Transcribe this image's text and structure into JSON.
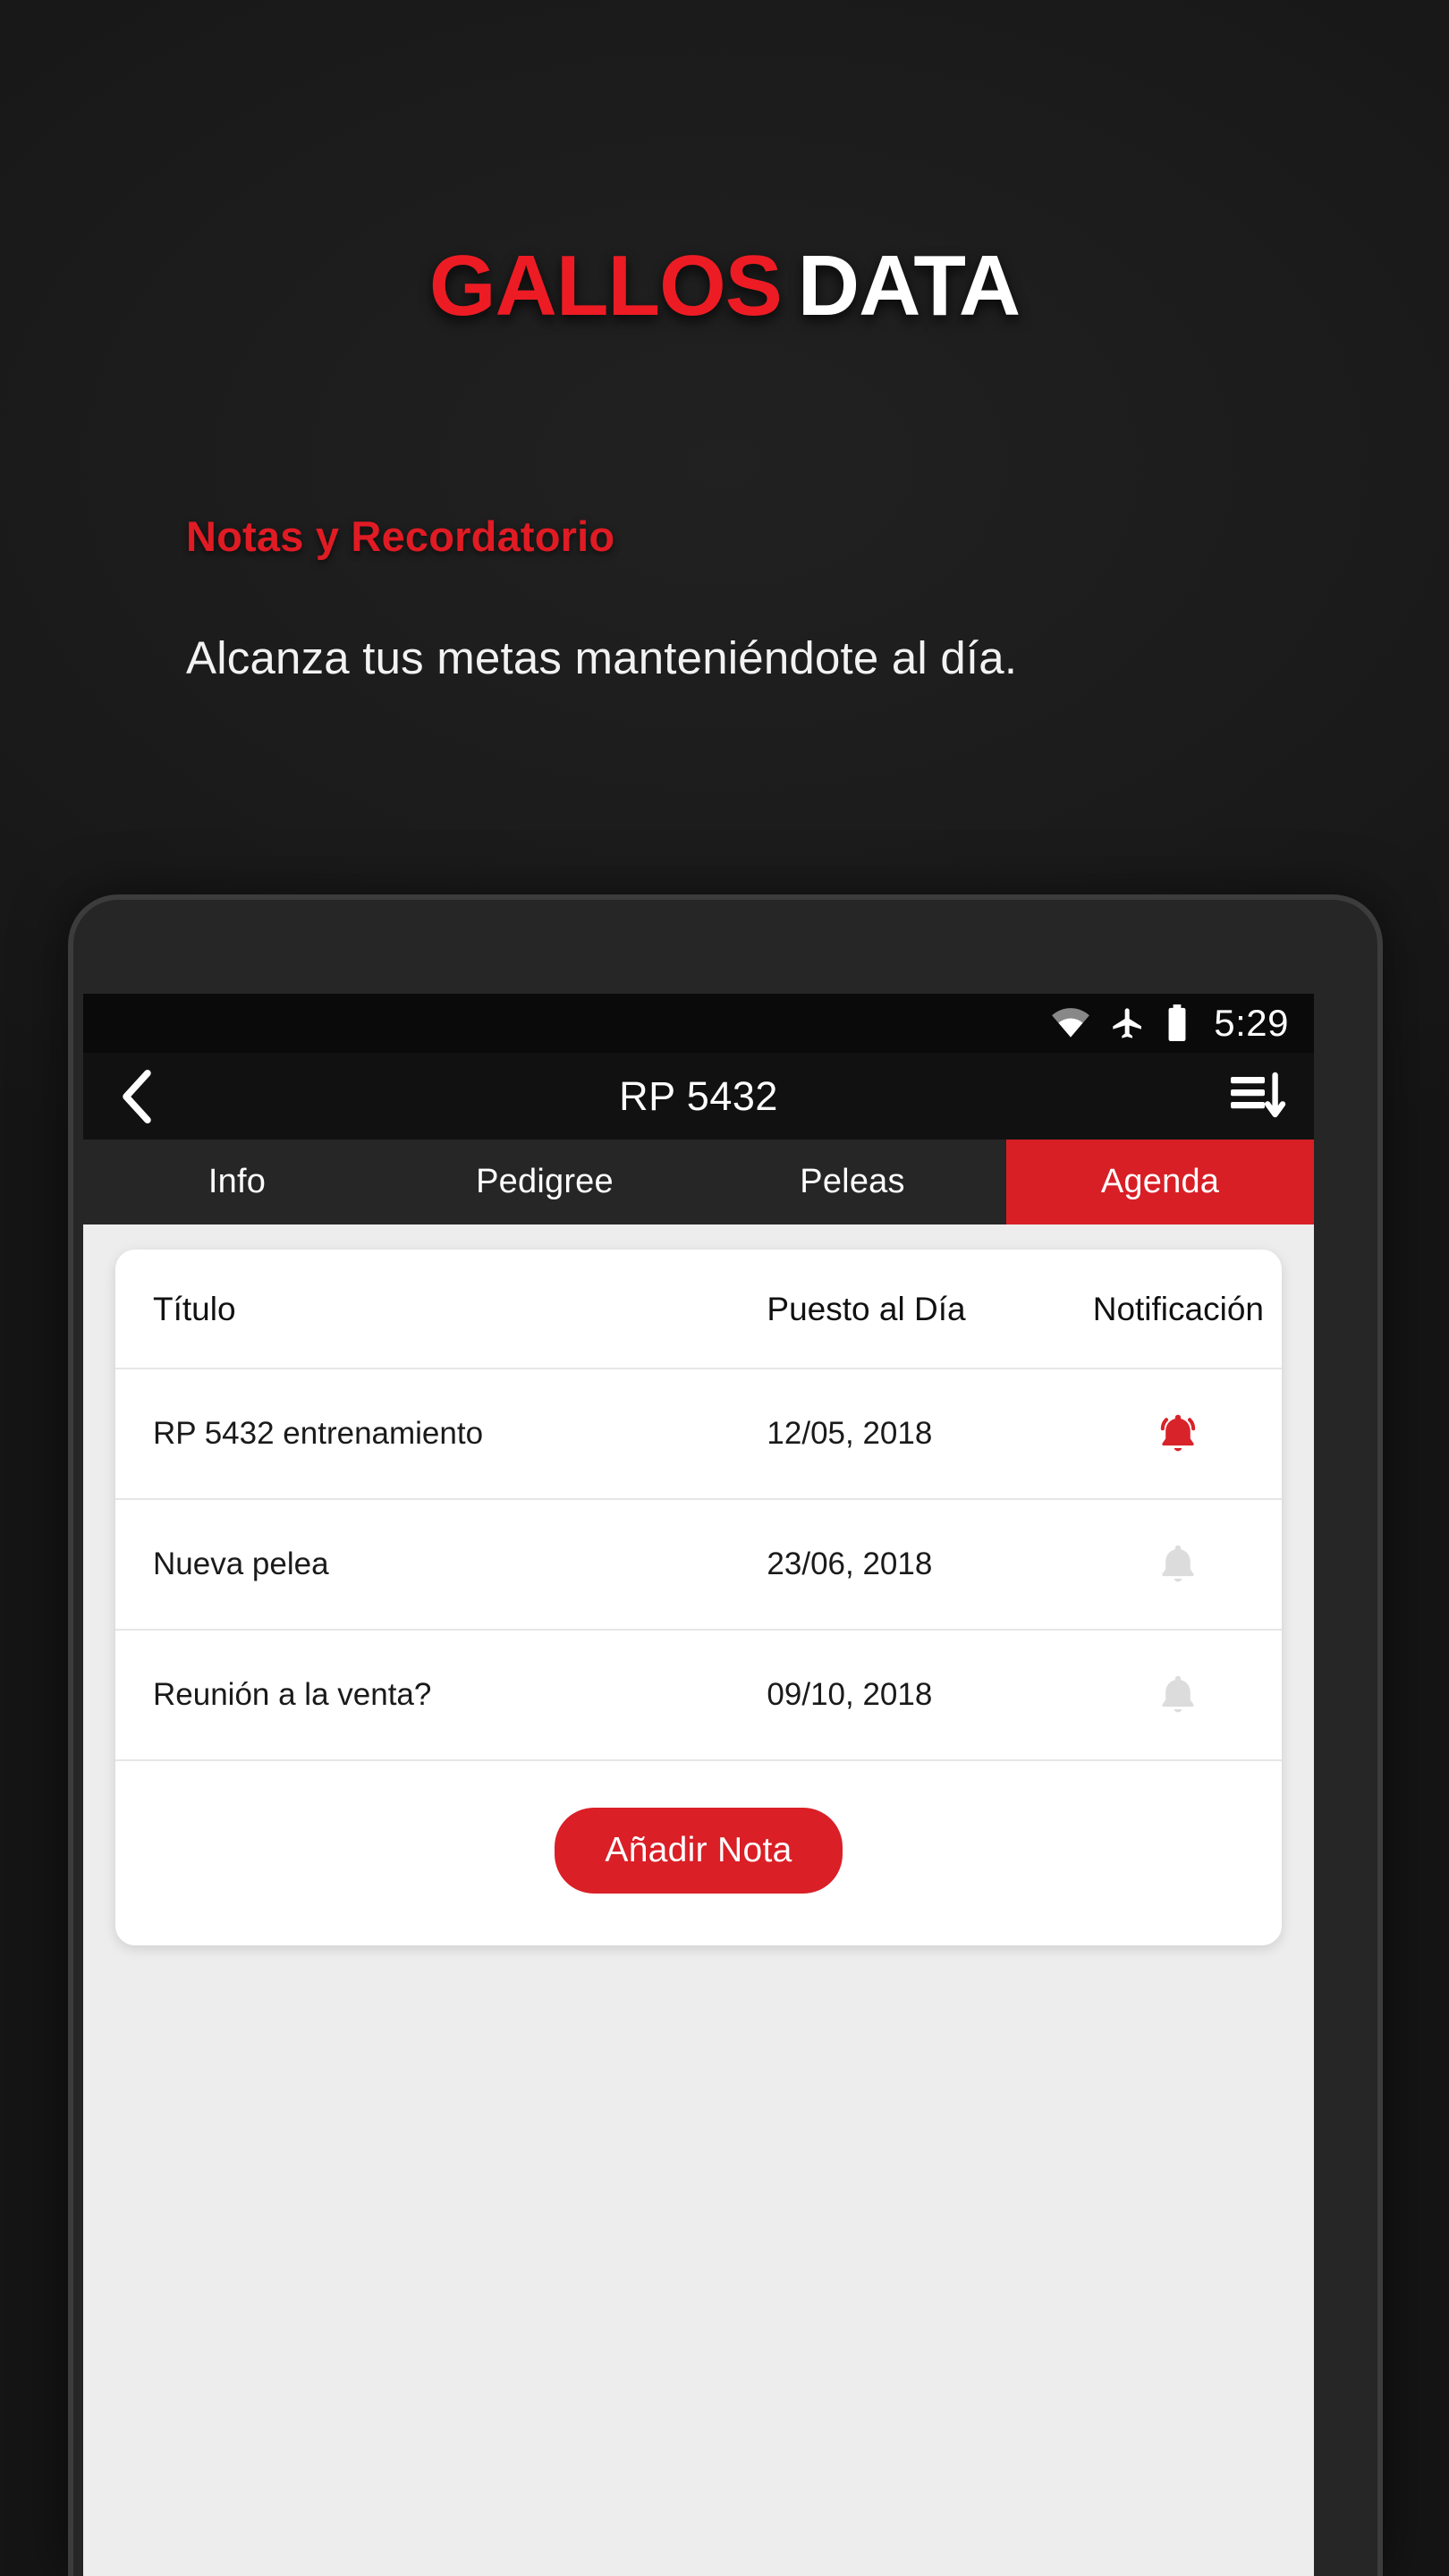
{
  "brand": {
    "word_one": "GALLOS",
    "word_two": "DATA",
    "red": "#ED1C24",
    "white": "#FFFFFF"
  },
  "promo": {
    "heading": "Notas y Recordatorio",
    "body": "Alcanza tus metas manteniéndote al día."
  },
  "phone": {
    "status_bar": {
      "time": "5:29",
      "icons": [
        "wifi-icon",
        "airplane-mode-icon",
        "battery-full-icon"
      ]
    },
    "app_bar": {
      "back_icon": "chevron-left-icon",
      "title": "RP 5432",
      "sort_icon": "sort-descending-icon"
    },
    "tabs": [
      {
        "label": "Info",
        "active": false
      },
      {
        "label": "Pedigree",
        "active": false
      },
      {
        "label": "Peleas",
        "active": false
      },
      {
        "label": "Agenda",
        "active": true
      }
    ],
    "agenda": {
      "columns": [
        "Título",
        "Puesto al Día",
        "Notificación"
      ],
      "rows": [
        {
          "title": "RP 5432 entrenamiento",
          "date": "12/05, 2018",
          "notification": "on",
          "notification_icon": "bell-ringing-icon"
        },
        {
          "title": "Nueva pelea",
          "date": "23/06, 2018",
          "notification": "off",
          "notification_icon": "bell-icon"
        },
        {
          "title": "Reunión a la venta?",
          "date": "09/10, 2018",
          "notification": "off",
          "notification_icon": "bell-icon"
        }
      ],
      "add_button_label": "Añadir Nota"
    }
  },
  "colors": {
    "accent_red": "#D81F26",
    "button_red": "#DA1F26",
    "page_background": "#1A1A1A",
    "screen_background": "#EDEDED",
    "card_background": "#FFFFFF",
    "bell_active": "#D8232A",
    "bell_inactive": "#DCDCDC"
  }
}
